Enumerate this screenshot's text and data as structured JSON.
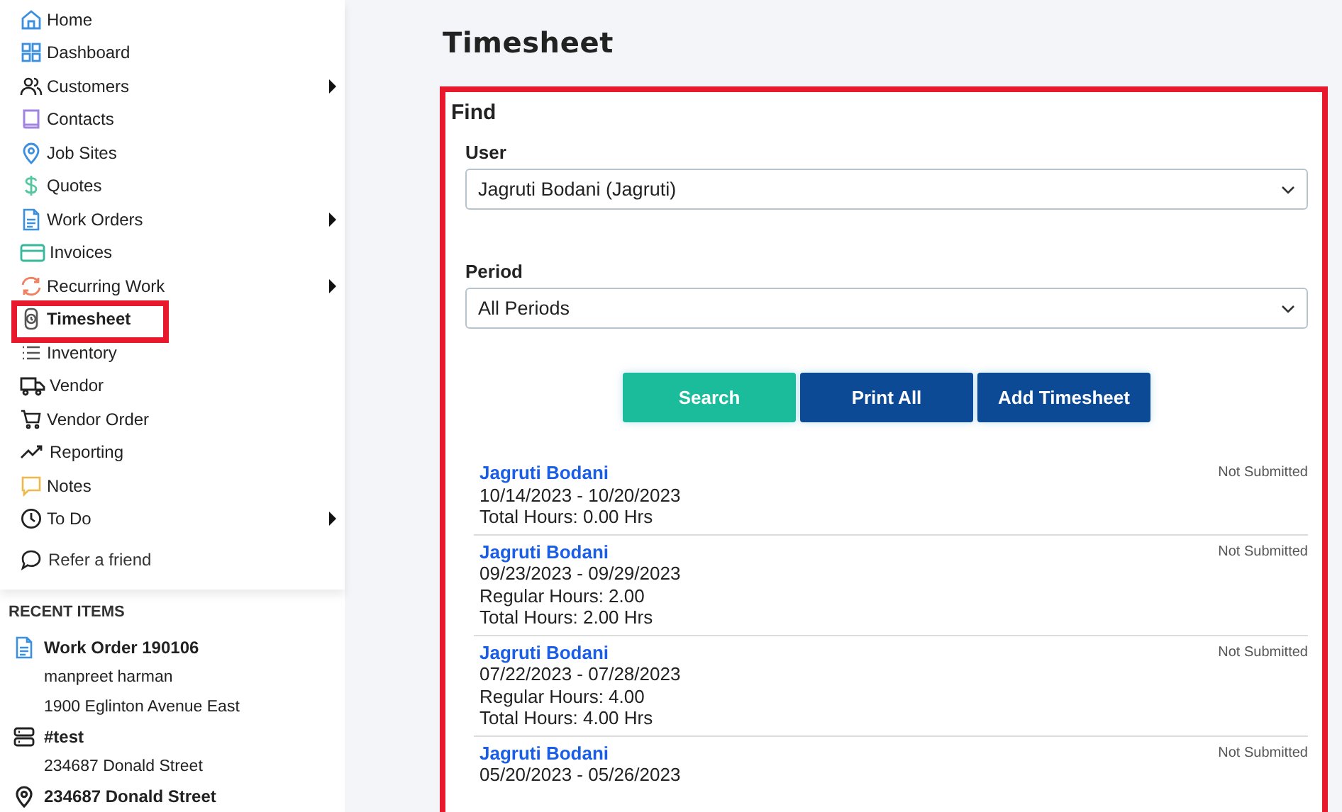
{
  "sidebar": {
    "items": [
      {
        "label": "Home",
        "selected": false,
        "has_submenu": false,
        "highlighted": false
      },
      {
        "label": "Dashboard",
        "selected": false,
        "has_submenu": false,
        "highlighted": false
      },
      {
        "label": "Customers",
        "selected": false,
        "has_submenu": true,
        "highlighted": false
      },
      {
        "label": "Contacts",
        "selected": false,
        "has_submenu": false,
        "highlighted": false
      },
      {
        "label": "Job Sites",
        "selected": false,
        "has_submenu": false,
        "highlighted": false
      },
      {
        "label": "Quotes",
        "selected": false,
        "has_submenu": false,
        "highlighted": false
      },
      {
        "label": "Work Orders",
        "selected": false,
        "has_submenu": true,
        "highlighted": false
      },
      {
        "label": "Invoices",
        "selected": false,
        "has_submenu": false,
        "highlighted": false
      },
      {
        "label": "Recurring Work",
        "selected": false,
        "has_submenu": true,
        "highlighted": false
      },
      {
        "label": "Timesheet",
        "selected": true,
        "has_submenu": false,
        "highlighted": true
      },
      {
        "label": "Inventory",
        "selected": false,
        "has_submenu": false,
        "highlighted": false
      },
      {
        "label": "Vendor",
        "selected": false,
        "has_submenu": false,
        "highlighted": false
      },
      {
        "label": "Vendor Order",
        "selected": false,
        "has_submenu": false,
        "highlighted": false
      },
      {
        "label": "Reporting",
        "selected": false,
        "has_submenu": false,
        "highlighted": false
      },
      {
        "label": "Notes",
        "selected": false,
        "has_submenu": false,
        "highlighted": false
      },
      {
        "label": "To Do",
        "selected": false,
        "has_submenu": true,
        "highlighted": false
      }
    ],
    "refer_link": "Refer a friend",
    "recent_items": {
      "title": "RECENT ITEMS",
      "items": [
        {
          "kind": "work-order",
          "title": "Work Order 190106",
          "details": [
            "manpreet harman",
            "1900 Eglinton Avenue East"
          ]
        },
        {
          "kind": "equipment",
          "title": "#test",
          "details": [
            "234687 Donald Street"
          ]
        },
        {
          "kind": "job-site",
          "title": "234687 Donald Street"
        }
      ]
    }
  },
  "page": {
    "title": "Timesheet",
    "find": {
      "title": "Find",
      "highlighted": true,
      "user": {
        "label": "User",
        "value": "Jagruti Bodani (Jagruti)"
      },
      "period": {
        "label": "Period",
        "value": "All Periods"
      },
      "buttons": [
        {
          "label": "Search",
          "kind": "primary"
        },
        {
          "label": "Print All",
          "kind": "secondary"
        },
        {
          "label": "Add Timesheet",
          "kind": "secondary"
        }
      ]
    },
    "timesheets": [
      {
        "name": "Jagruti Bodani",
        "range": "10/14/2023 - 10/20/2023",
        "lines": [
          "Total Hours: 0.00 Hrs"
        ],
        "status": "Not Submitted"
      },
      {
        "name": "Jagruti Bodani",
        "range": "09/23/2023 - 09/29/2023",
        "lines": [
          "Regular Hours: 2.00",
          "Total Hours: 2.00 Hrs"
        ],
        "status": "Not Submitted"
      },
      {
        "name": "Jagruti Bodani",
        "range": "07/22/2023 - 07/28/2023",
        "lines": [
          "Regular Hours: 4.00",
          "Total Hours: 4.00 Hrs"
        ],
        "status": "Not Submitted"
      },
      {
        "name": "Jagruti Bodani",
        "range": "05/20/2023 - 05/26/2023",
        "status": "Not Submitted"
      }
    ]
  }
}
